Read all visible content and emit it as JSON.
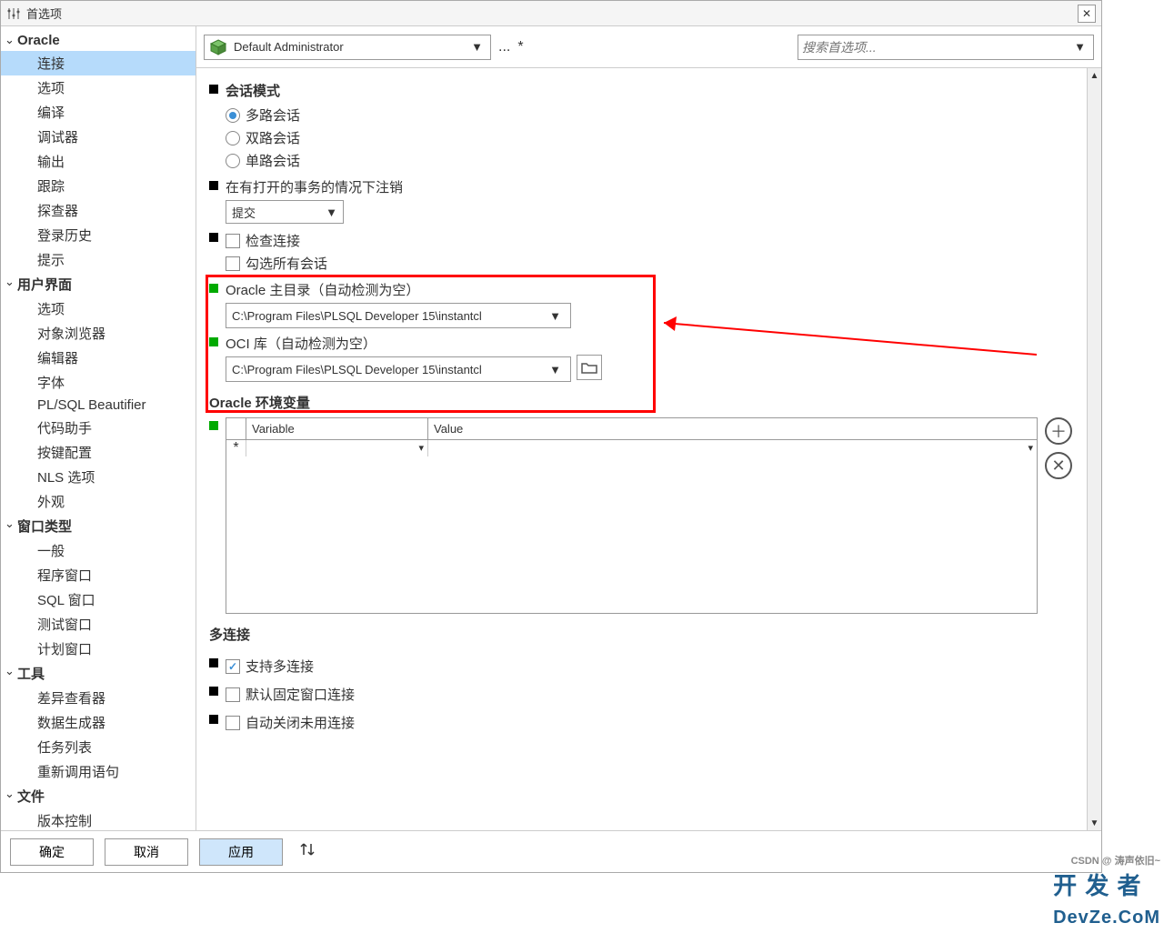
{
  "window": {
    "title": "首选项"
  },
  "sidebar": {
    "groups": [
      {
        "label": "Oracle",
        "items": [
          "连接",
          "选项",
          "编译",
          "调试器",
          "输出",
          "跟踪",
          "探查器",
          "登录历史",
          "提示"
        ],
        "selected": 0
      },
      {
        "label": "用户界面",
        "items": [
          "选项",
          "对象浏览器",
          "编辑器",
          "字体",
          "PL/SQL Beautifier",
          "代码助手",
          "按键配置",
          "NLS 选项",
          "外观"
        ]
      },
      {
        "label": "窗口类型",
        "items": [
          "一般",
          "程序窗口",
          "SQL 窗口",
          "测试窗口",
          "计划窗口"
        ]
      },
      {
        "label": "工具",
        "items": [
          "差异查看器",
          "数据生成器",
          "任务列表",
          "重新调用语句"
        ]
      },
      {
        "label": "文件",
        "items": [
          "版本控制"
        ]
      }
    ]
  },
  "toolbar": {
    "admin": "Default Administrator",
    "dots": "...",
    "star": "*",
    "search_placeholder": "搜索首选项..."
  },
  "session": {
    "title": "会话模式",
    "opts": [
      "多路会话",
      "双路会话",
      "单路会话"
    ],
    "selected": 0
  },
  "logoff": {
    "label": "在有打开的事务的情况下注销",
    "value": "提交"
  },
  "checks1": [
    "检查连接",
    "勾选所有会话"
  ],
  "oracle_home": {
    "label": "Oracle 主目录（自动检测为空）",
    "value": "C:\\Program Files\\PLSQL Developer 15\\instantcl"
  },
  "oci_lib": {
    "label": "OCI 库（自动检测为空）",
    "value": "C:\\Program Files\\PLSQL Developer 15\\instantcl"
  },
  "env": {
    "heading": "Oracle 环境变量",
    "col1": "Variable",
    "col2": "Value",
    "rowmark": "*"
  },
  "multi": {
    "heading": "多连接",
    "c1": "支持多连接",
    "c2": "默认固定窗口连接",
    "c3": "自动关闭未用连接"
  },
  "footer": {
    "ok": "确定",
    "cancel": "取消",
    "apply": "应用"
  },
  "watermark": {
    "sub": "CSDN @ 涛声依旧~",
    "main1": "开 发 者",
    "main2": "DevZe.CoM"
  }
}
